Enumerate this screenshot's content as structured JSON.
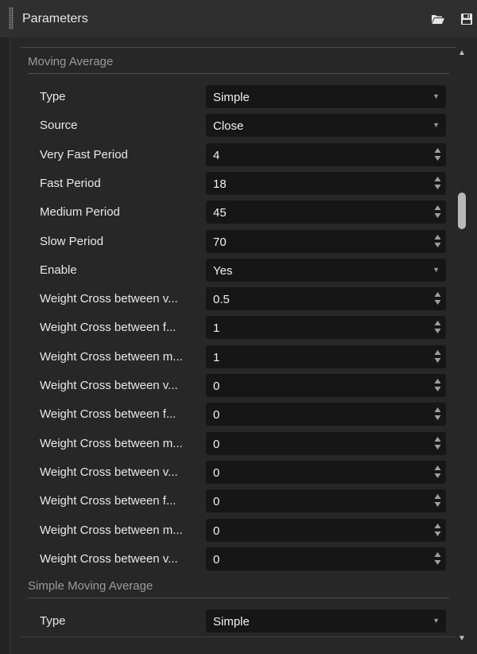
{
  "header": {
    "title": "Parameters",
    "open_icon": "folder-open-icon",
    "save_icon": "floppy-disk-icon"
  },
  "sections": [
    {
      "title": "Moving Average",
      "rows": [
        {
          "label": "Type",
          "value": "Simple",
          "control": "dropdown"
        },
        {
          "label": "Source",
          "value": "Close",
          "control": "dropdown"
        },
        {
          "label": "Very Fast Period",
          "value": "4",
          "control": "spinner"
        },
        {
          "label": "Fast Period",
          "value": "18",
          "control": "spinner"
        },
        {
          "label": "Medium Period",
          "value": "45",
          "control": "spinner"
        },
        {
          "label": "Slow Period",
          "value": "70",
          "control": "spinner"
        },
        {
          "label": "Enable",
          "value": "Yes",
          "control": "dropdown"
        },
        {
          "label": "Weight Cross between v...",
          "value": "0.5",
          "control": "spinner"
        },
        {
          "label": "Weight Cross between f...",
          "value": "1",
          "control": "spinner"
        },
        {
          "label": "Weight Cross between m...",
          "value": "1",
          "control": "spinner"
        },
        {
          "label": "Weight Cross between v...",
          "value": "0",
          "control": "spinner"
        },
        {
          "label": "Weight Cross between f...",
          "value": "0",
          "control": "spinner"
        },
        {
          "label": "Weight Cross between m...",
          "value": "0",
          "control": "spinner"
        },
        {
          "label": "Weight Cross between v...",
          "value": "0",
          "control": "spinner"
        },
        {
          "label": "Weight Cross between f...",
          "value": "0",
          "control": "spinner"
        },
        {
          "label": "Weight Cross between m...",
          "value": "0",
          "control": "spinner"
        },
        {
          "label": "Weight Cross between v...",
          "value": "0",
          "control": "spinner"
        }
      ]
    },
    {
      "title": "Simple Moving Average",
      "rows": [
        {
          "label": "Type",
          "value": "Simple",
          "control": "dropdown"
        }
      ]
    }
  ],
  "scrollbar": {
    "up_icon": "scroll-up-arrow-icon",
    "down_icon": "scroll-down-arrow-icon"
  },
  "colors": {
    "background": "#232323",
    "field": "#161616",
    "label": "#e8e8e8",
    "section_header": "#9a9a9a"
  }
}
